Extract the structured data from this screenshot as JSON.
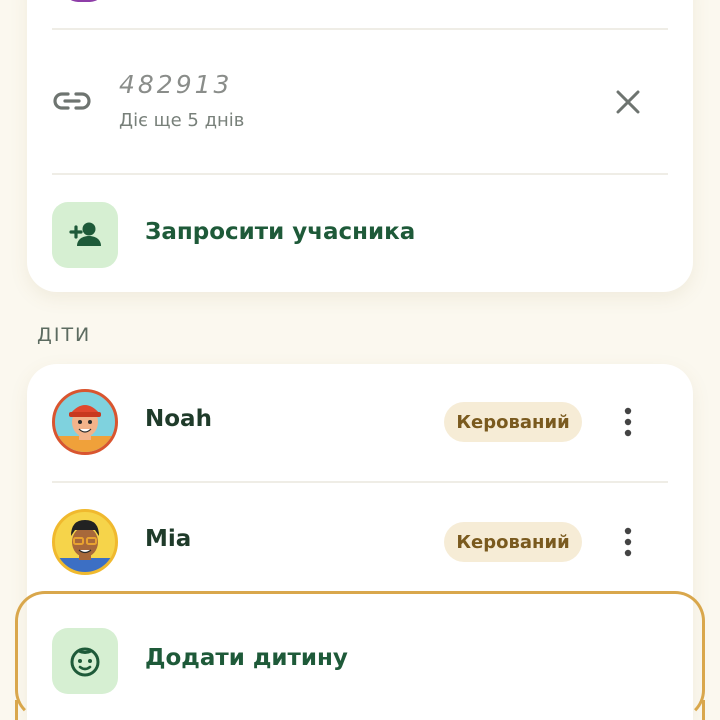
{
  "invite": {
    "code": "482913",
    "expires": "Діє ще 5 днів",
    "invite_member_label": "Запросити учасника"
  },
  "children_section": {
    "title": "ДІТИ",
    "children": [
      {
        "name": "Noah",
        "badge": "Керований"
      },
      {
        "name": "Mia",
        "badge": "Керований"
      }
    ],
    "add_child_label": "Додати дитину"
  },
  "colors": {
    "accent_green": "#1e5a39",
    "tile_green": "#d6efd2",
    "badge_bg": "#f6ecd6",
    "highlight": "#d9a74c"
  }
}
